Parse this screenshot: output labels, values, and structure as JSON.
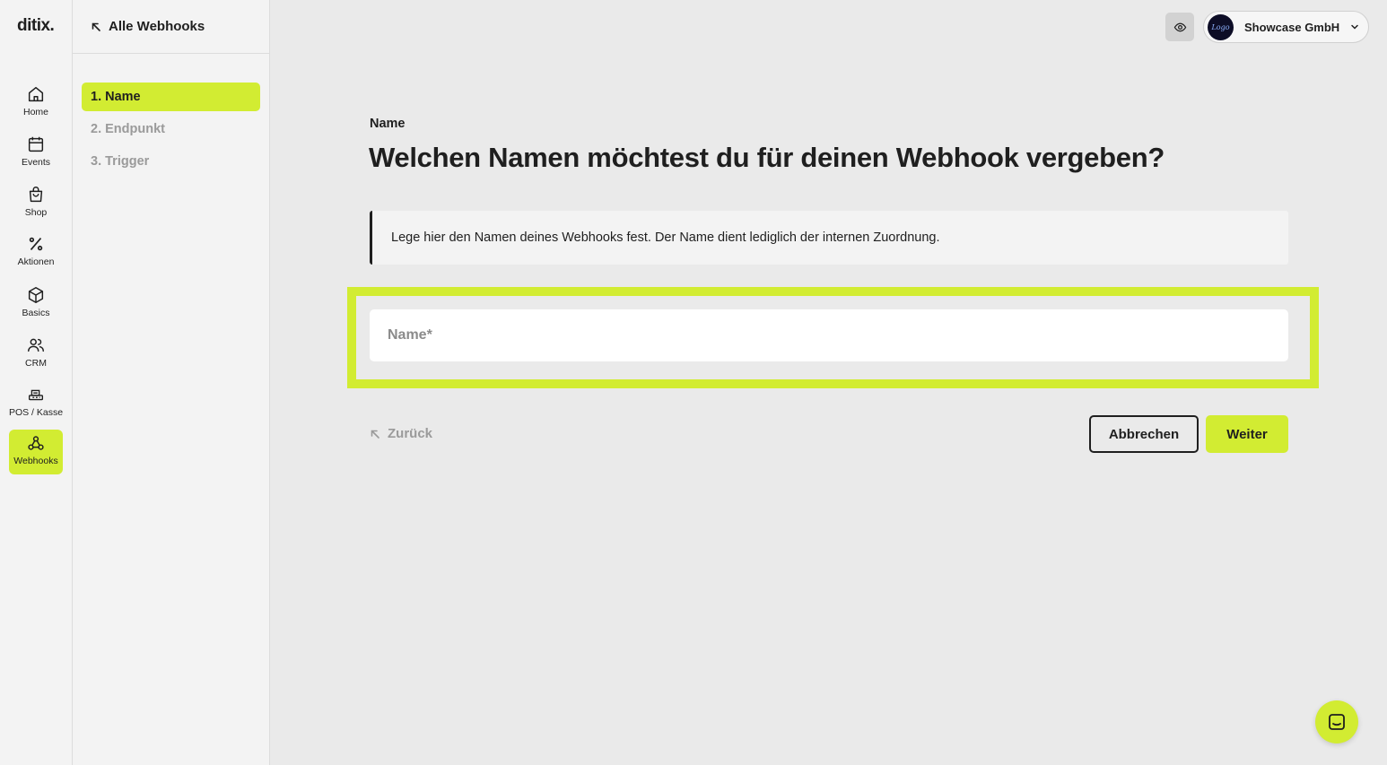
{
  "brand": {
    "logo": "ditix.",
    "accent": "#d2ec32"
  },
  "nav": {
    "items": [
      {
        "label": "Home",
        "icon": "home-icon"
      },
      {
        "label": "Events",
        "icon": "calendar-icon"
      },
      {
        "label": "Shop",
        "icon": "shopping-bag-icon"
      },
      {
        "label": "Aktionen",
        "icon": "percent-icon"
      },
      {
        "label": "Basics",
        "icon": "box-icon"
      },
      {
        "label": "CRM",
        "icon": "users-icon"
      },
      {
        "label": "POS / Kasse",
        "icon": "pos-terminal-icon"
      },
      {
        "label": "Webhooks",
        "icon": "webhook-icon",
        "active": true
      }
    ]
  },
  "steps": {
    "back_label": "Alle Webhooks",
    "items": [
      {
        "label": "1. Name",
        "active": true
      },
      {
        "label": "2. Endpunkt"
      },
      {
        "label": "3. Trigger"
      }
    ]
  },
  "account": {
    "name": "Showcase GmbH",
    "avatar_text": "Logo"
  },
  "main": {
    "eyebrow": "Name",
    "title": "Welchen Namen möchtest du für deinen Webhook vergeben?",
    "note": "Lege hier den Namen deines Webhooks fest. Der Name dient lediglich der internen Zuordnung.",
    "name_input": {
      "placeholder": "Name*",
      "value": ""
    },
    "back_label": "Zurück",
    "cancel_label": "Abbrechen",
    "next_label": "Weiter"
  }
}
